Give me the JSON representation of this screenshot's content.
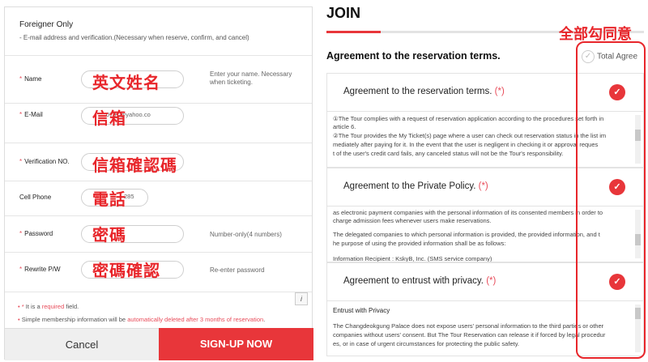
{
  "signup": {
    "header_title": "Foreigner Only",
    "header_sub": "- E-mail address and verification.(Necessary when reserve, confirm, and cancel)",
    "fields": [
      {
        "label": "Name",
        "required": true,
        "value": "",
        "hint": "Enter your name. Necessary when ticketing.",
        "overlay": "英文姓名"
      },
      {
        "label": "E-Mail",
        "required": true,
        "value": "0701@yahoo.co",
        "hint": "",
        "overlay": "信箱"
      },
      {
        "label": "Verification NO.",
        "required": true,
        "value": "",
        "hint": "",
        "overlay": "信箱確認碼"
      },
      {
        "label": "Cell Phone",
        "required": false,
        "value": "285",
        "hint": "",
        "overlay": "電話"
      },
      {
        "label": "Password",
        "required": true,
        "value": "",
        "hint": "Number-only(4 numbers)",
        "overlay": "密碼"
      },
      {
        "label": "Rewrite P/W",
        "required": true,
        "value": "",
        "hint": "Re-enter password",
        "overlay": "密碼確認"
      }
    ],
    "star": "*",
    "note1_pre": "It is a ",
    "note1_red": "required",
    "note1_post": " field.",
    "note2_pre": "Simple membership information will be ",
    "note2_red": "automatically deleted after 3 months of reservation",
    "note2_post": ".",
    "info_icon": "i",
    "cancel_label": "Cancel",
    "signup_label": "SIGN-UP NOW"
  },
  "join": {
    "title": "JOIN",
    "progress": 0.17,
    "section_title": "Agreement to the reservation terms.",
    "total_agree": "Total Agree",
    "annotation_all": "全部勾同意",
    "sections": [
      {
        "title": "Agreement to the reservation terms.",
        "req": "(*)",
        "lines": [
          "①The Tour complies with a request of reservation application according to the procedures set forth in",
          "article 6.",
          "②The Tour provides the My Ticket(s) page where a user can check out reservation status in the list im",
          "mediately after paying for it. In the event that the user is negligent in checking it or approval reques",
          "t of the user's credit card fails, any canceled status will not be the Tour's responsibility."
        ]
      },
      {
        "title": "Agreement to the Private Policy.",
        "req": "(*)",
        "lines": [
          "as electronic payment companies with the personal information of its consented members in order to",
          "charge admission fees whenever users make reservations.",
          "",
          "The delegated companies to which personal information is provided, the provided information, and t",
          "he purpose of using the provided information shall be as follows:",
          "",
          "Information Recipient : KskyB, Inc. (SMS service company)"
        ]
      },
      {
        "title": "Agreement to entrust with privacy.",
        "req": "(*)",
        "subheading": "Entrust with Privacy",
        "lines": [
          "The Changdeokgung Palace does not expose users' personal information to the third parties or other",
          "companies without users' consent. But The Tour Reservation can release it if forced by legal procedur",
          "es, or in case of urgent circumstances for protecting the public safety."
        ]
      }
    ]
  },
  "colors": {
    "accent": "#e8363a",
    "annotation": "#e8262b"
  }
}
